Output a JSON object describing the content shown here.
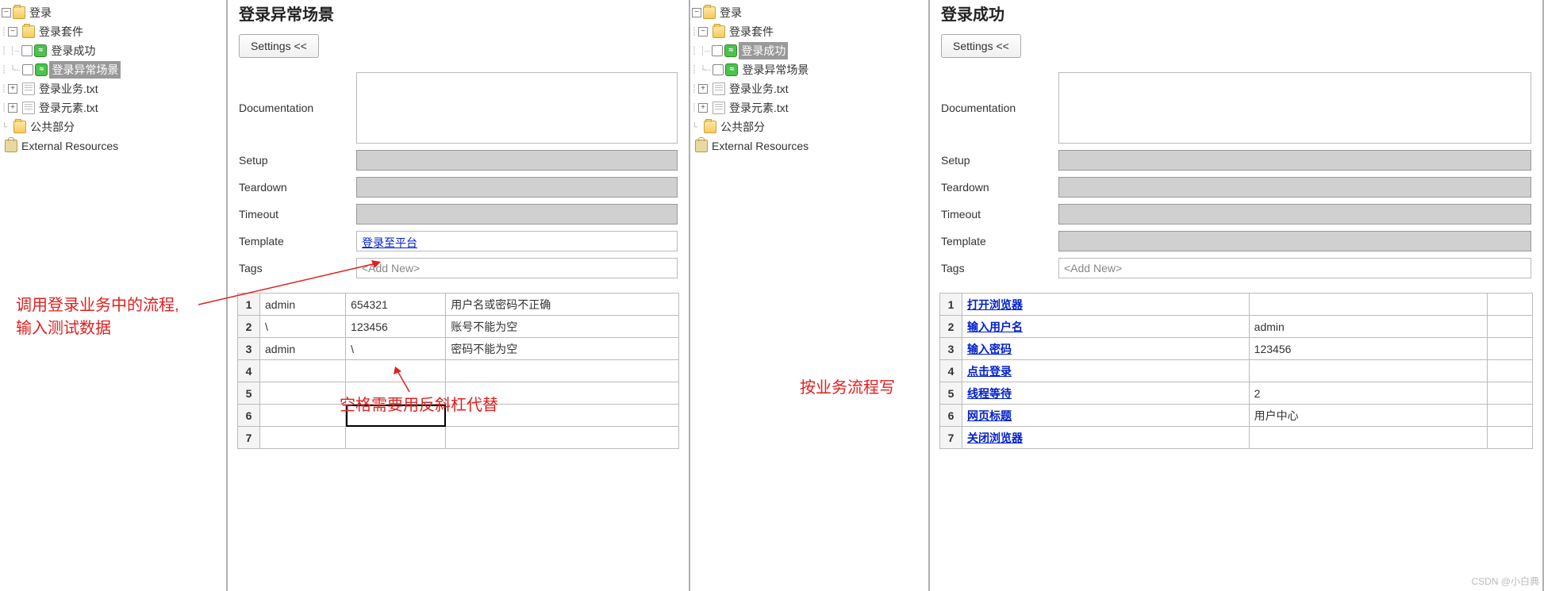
{
  "left": {
    "tree": {
      "root": "登录",
      "suite": "登录套件",
      "case_success": "登录成功",
      "case_fail": "登录异常场景",
      "file1": "登录业务.txt",
      "file2": "登录元素.txt",
      "common": "公共部分",
      "external": "External Resources"
    },
    "editor": {
      "title": "登录异常场景",
      "settings_btn": "Settings <<",
      "labels": {
        "doc": "Documentation",
        "setup": "Setup",
        "teardown": "Teardown",
        "timeout": "Timeout",
        "template": "Template",
        "tags": "Tags"
      },
      "template_link": "登录至平台",
      "tags_placeholder": "<Add New>",
      "rows": [
        {
          "n": "1",
          "a": "admin",
          "b": "654321",
          "c": "用户名或密码不正确"
        },
        {
          "n": "2",
          "a": "\\",
          "b": "123456",
          "c": "账号不能为空"
        },
        {
          "n": "3",
          "a": "admin",
          "b": "\\",
          "c": "密码不能为空"
        },
        {
          "n": "4",
          "a": "",
          "b": "",
          "c": ""
        },
        {
          "n": "5",
          "a": "",
          "b": "",
          "c": ""
        },
        {
          "n": "6",
          "a": "",
          "b": "",
          "c": ""
        },
        {
          "n": "7",
          "a": "",
          "b": "",
          "c": ""
        }
      ]
    },
    "annot1a": "调用登录业务中的流程,",
    "annot1b": "输入测试数据",
    "annot2": "空格需要用反斜杠代替"
  },
  "right": {
    "tree": {
      "root": "登录",
      "suite": "登录套件",
      "case_success": "登录成功",
      "case_fail": "登录异常场景",
      "file1": "登录业务.txt",
      "file2": "登录元素.txt",
      "common": "公共部分",
      "external": "External Resources"
    },
    "editor": {
      "title": "登录成功",
      "settings_btn": "Settings <<",
      "labels": {
        "doc": "Documentation",
        "setup": "Setup",
        "teardown": "Teardown",
        "timeout": "Timeout",
        "template": "Template",
        "tags": "Tags"
      },
      "tags_placeholder": "<Add New>",
      "rows": [
        {
          "n": "1",
          "kw": "打开浏览器",
          "a": ""
        },
        {
          "n": "2",
          "kw": "输入用户名",
          "a": "admin"
        },
        {
          "n": "3",
          "kw": "输入密码",
          "a": "123456"
        },
        {
          "n": "4",
          "kw": "点击登录",
          "a": ""
        },
        {
          "n": "5",
          "kw": "线程等待",
          "a": "2"
        },
        {
          "n": "6",
          "kw": "网页标题",
          "a": "用户中心"
        },
        {
          "n": "7",
          "kw": "关闭浏览器",
          "a": ""
        }
      ]
    },
    "annot": "按业务流程写"
  },
  "watermark": "CSDN @小白典"
}
